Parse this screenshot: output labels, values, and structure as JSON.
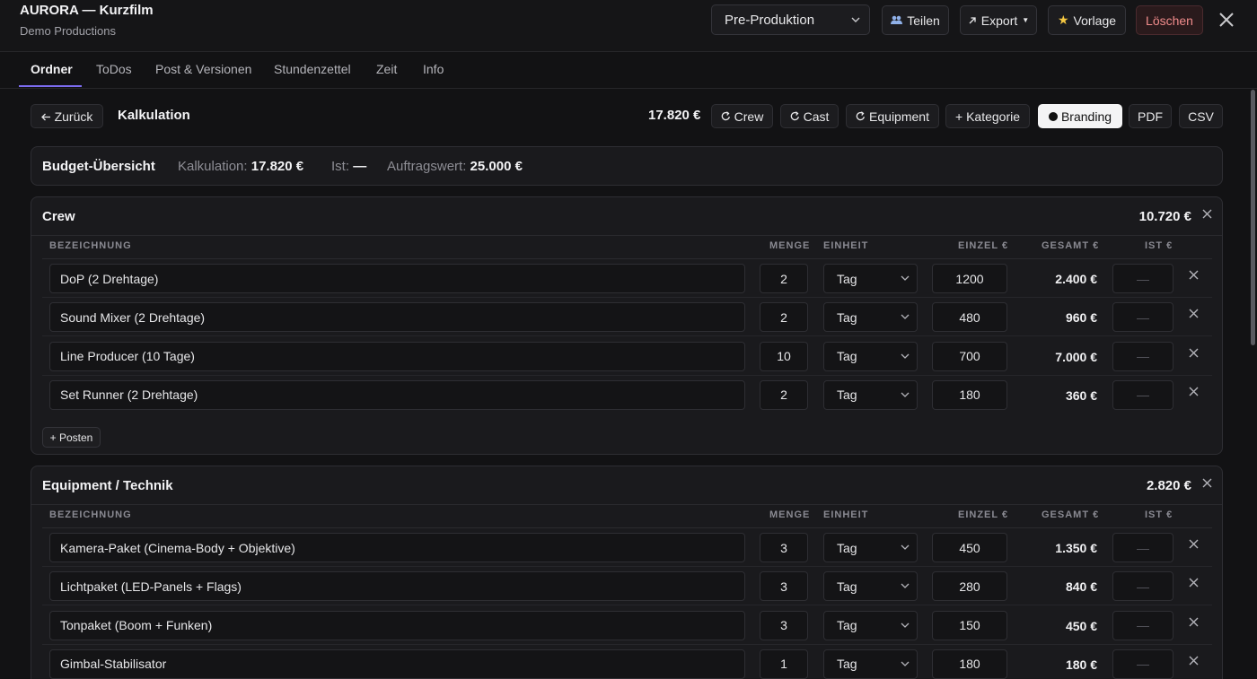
{
  "header": {
    "title": "AURORA — Kurzfilm",
    "subtitle": "Demo Productions",
    "status": "Pre-Produktion",
    "share": "Teilen",
    "export": "Export",
    "template": "Vorlage",
    "delete": "Löschen"
  },
  "tabs": [
    "Ordner",
    "ToDos",
    "Post & Versionen",
    "Stundenzettel",
    "Zeit",
    "Info"
  ],
  "toolbar": {
    "back": "Zurück",
    "title": "Kalkulation",
    "total": "17.820 €",
    "crew": "Crew",
    "cast": "Cast",
    "equipment": "Equipment",
    "category": "+ Kategorie",
    "branding": "Branding",
    "pdf": "PDF",
    "csv": "CSV"
  },
  "budget": {
    "title": "Budget-Übersicht",
    "calc_label": "Kalkulation:",
    "calc_value": "17.820 €",
    "actual_label": "Ist:",
    "actual_value": "—",
    "order_label": "Auftragswert:",
    "order_value": "25.000 €"
  },
  "columns": {
    "name": "BEZEICHNUNG",
    "qty": "MENGE",
    "unit": "EINHEIT",
    "price": "EINZEL €",
    "total": "GESAMT €",
    "actual": "IST €"
  },
  "sections": [
    {
      "title": "Crew",
      "total": "10.720 €",
      "add_label": "+ Posten",
      "rows": [
        {
          "name": "DoP (2 Drehtage)",
          "qty": "2",
          "unit": "Tag",
          "price": "1200",
          "total": "2.400 €",
          "actual": "—"
        },
        {
          "name": "Sound Mixer (2 Drehtage)",
          "qty": "2",
          "unit": "Tag",
          "price": "480",
          "total": "960 €",
          "actual": "—"
        },
        {
          "name": "Line Producer (10 Tage)",
          "qty": "10",
          "unit": "Tag",
          "price": "700",
          "total": "7.000 €",
          "actual": "—"
        },
        {
          "name": "Set Runner (2 Drehtage)",
          "qty": "2",
          "unit": "Tag",
          "price": "180",
          "total": "360 €",
          "actual": "—"
        }
      ]
    },
    {
      "title": "Equipment / Technik",
      "total": "2.820 €",
      "rows": [
        {
          "name": "Kamera-Paket (Cinema-Body + Objektive)",
          "qty": "3",
          "unit": "Tag",
          "price": "450",
          "total": "1.350 €",
          "actual": "—"
        },
        {
          "name": "Lichtpaket (LED-Panels + Flags)",
          "qty": "3",
          "unit": "Tag",
          "price": "280",
          "total": "840 €",
          "actual": "—"
        },
        {
          "name": "Tonpaket (Boom + Funken)",
          "qty": "3",
          "unit": "Tag",
          "price": "150",
          "total": "450 €",
          "actual": "—"
        },
        {
          "name": "Gimbal-Stabilisator",
          "qty": "1",
          "unit": "Tag",
          "price": "180",
          "total": "180 €",
          "actual": "—"
        }
      ]
    }
  ]
}
